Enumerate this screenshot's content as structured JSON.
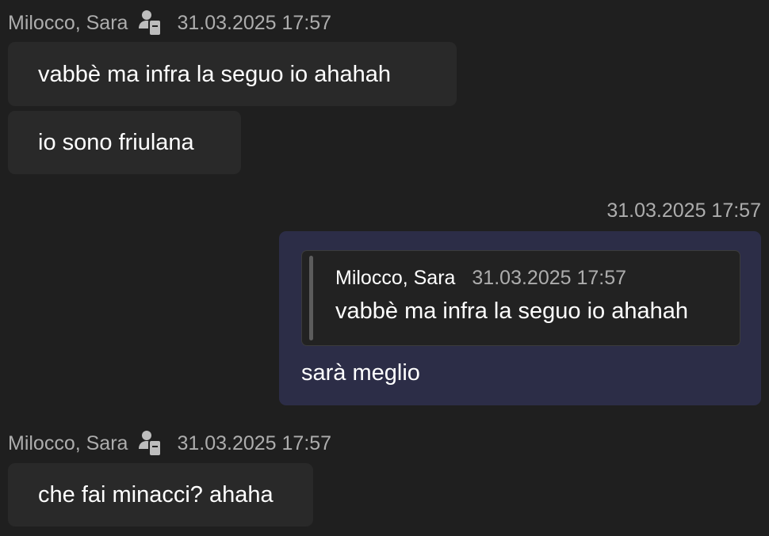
{
  "messages": [
    {
      "sender": "Milocco, Sara",
      "sender_icon": "external-user-icon",
      "timestamp": "31.03.2025 17:57",
      "bubbles": [
        "vabbè ma infra la seguo io ahahah",
        "io sono friulana"
      ]
    },
    {
      "outgoing": true,
      "timestamp": "31.03.2025 17:57",
      "quote": {
        "sender": "Milocco, Sara",
        "timestamp": "31.03.2025 17:57",
        "text": "vabbè ma infra la seguo io ahahah"
      },
      "text": "sarà meglio"
    },
    {
      "sender": "Milocco, Sara",
      "sender_icon": "external-user-icon",
      "timestamp": "31.03.2025 17:57",
      "bubbles": [
        "che fai minacci? ahaha"
      ]
    }
  ],
  "colors": {
    "background": "#1f1f1f",
    "incoming_bubble": "#292929",
    "outgoing_bubble": "#2c2d47",
    "quote_background": "#222222",
    "meta_text": "#adadad"
  }
}
